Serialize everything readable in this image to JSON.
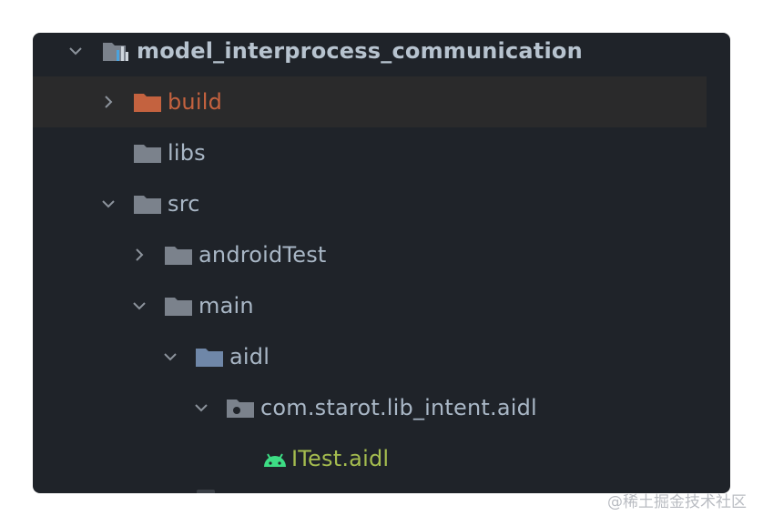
{
  "project_tree": {
    "root": {
      "label": "model_interprocess_communication",
      "icon": "module-folder-icon",
      "expanded": true
    },
    "items": [
      {
        "label": "build",
        "icon": "excluded-folder-icon",
        "expanded": false,
        "color": "#c4623f"
      },
      {
        "label": "libs",
        "icon": "folder-icon"
      },
      {
        "label": "src",
        "icon": "folder-icon",
        "expanded": true
      },
      {
        "label": "androidTest",
        "icon": "folder-icon",
        "expanded": false
      },
      {
        "label": "main",
        "icon": "folder-icon",
        "expanded": true
      },
      {
        "label": "aidl",
        "icon": "source-folder-icon",
        "expanded": true
      },
      {
        "label": "com.starot.lib_intent.aidl",
        "icon": "package-icon",
        "expanded": true
      },
      {
        "label": "ITest.aidl",
        "icon": "android-icon",
        "color": "#a5bd4f"
      }
    ]
  },
  "colors": {
    "background": "#1f2329",
    "selected_row": "#2a2a2b",
    "text": "#a9b7c6",
    "folder": "#7b828c",
    "excluded": "#c4623f",
    "android_green": "#3ddc84"
  },
  "watermark": "@稀土掘金技术社区"
}
